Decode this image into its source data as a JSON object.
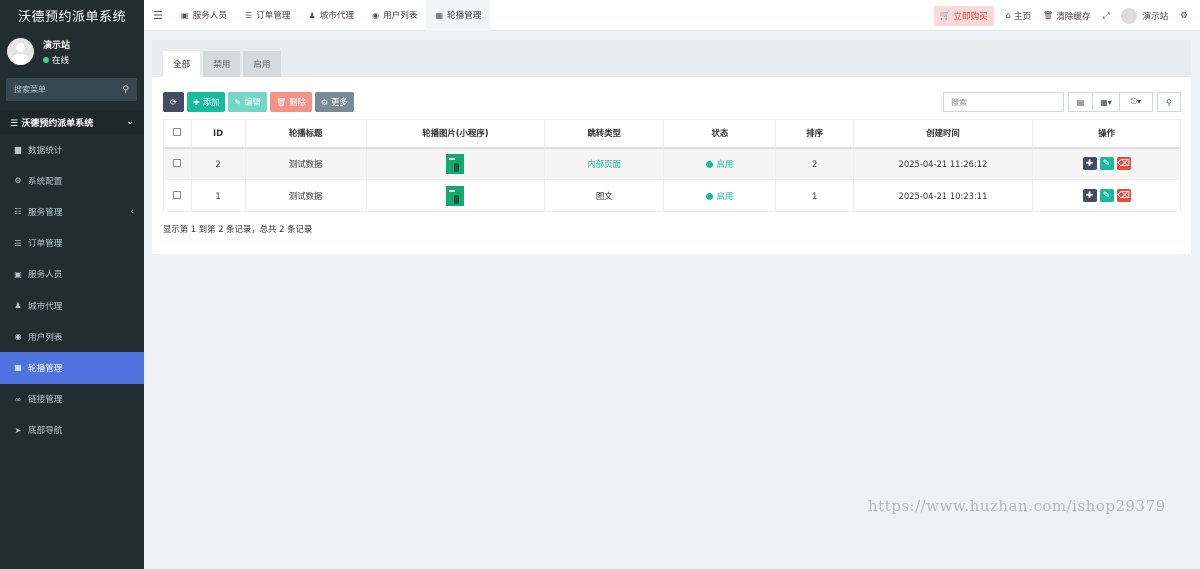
{
  "app": {
    "title": "沃德预约派单系统"
  },
  "user": {
    "name": "演示站",
    "status": "在线"
  },
  "sidebar": {
    "search_placeholder": "搜索菜单",
    "search_icon": "search-icon",
    "header": "沃德预约派单系统",
    "items": [
      {
        "label": "数据统计",
        "icon": "bar-chart-icon"
      },
      {
        "label": "系统配置",
        "icon": "gear-icon"
      },
      {
        "label": "服务管理",
        "icon": "list-icon"
      },
      {
        "label": "订单管理",
        "icon": "list-icon"
      },
      {
        "label": "服务人员",
        "icon": "id-card-icon"
      },
      {
        "label": "城市代理",
        "icon": "users-icon"
      },
      {
        "label": "用户列表",
        "icon": "user-circle-icon"
      },
      {
        "label": "轮播管理",
        "icon": "image-icon",
        "active": true
      },
      {
        "label": "链接管理",
        "icon": "link-icon"
      },
      {
        "label": "底部导航",
        "icon": "send-icon"
      }
    ]
  },
  "topbar": {
    "tabs": [
      {
        "label": "服务人员",
        "icon": "id-card-icon"
      },
      {
        "label": "订单管理",
        "icon": "list-icon"
      },
      {
        "label": "城市代理",
        "icon": "users-icon"
      },
      {
        "label": "用户列表",
        "icon": "user-circle-icon"
      },
      {
        "label": "轮播管理",
        "icon": "image-icon",
        "active": true
      }
    ],
    "buy_label": "立即购买",
    "home_label": "主页",
    "clear_cache_label": "清除缓存",
    "user_name": "演示站"
  },
  "filter_tabs": [
    "全部",
    "禁用",
    "启用"
  ],
  "toolbar": {
    "add_label": "添加",
    "edit_label": "编辑",
    "delete_label": "删除",
    "more_label": "更多",
    "search_placeholder": "搜索"
  },
  "table": {
    "headers": [
      "ID",
      "轮播标题",
      "轮播图片(小程序)",
      "跳转类型",
      "状态",
      "排序",
      "创建时间",
      "操作"
    ],
    "rows": [
      {
        "id": "2",
        "title": "测试数据",
        "jump_type": "内部页面",
        "status": "启用",
        "sort": "2",
        "created": "2025-04-21 11:26:12"
      },
      {
        "id": "1",
        "title": "测试数据",
        "jump_type": "图文",
        "status": "启用",
        "sort": "1",
        "created": "2025-04-21 10:23:11"
      }
    ]
  },
  "pager_text": "显示第 1 到第 2 条记录，总共 2 条记录",
  "watermark_url": "https://www.huzhan.com/ishop29379",
  "colors": {
    "primary": "#18bc9c",
    "sidebar": "#222d32",
    "active": "#4e73df",
    "danger": "#e74c3c",
    "dark": "#444c63"
  }
}
